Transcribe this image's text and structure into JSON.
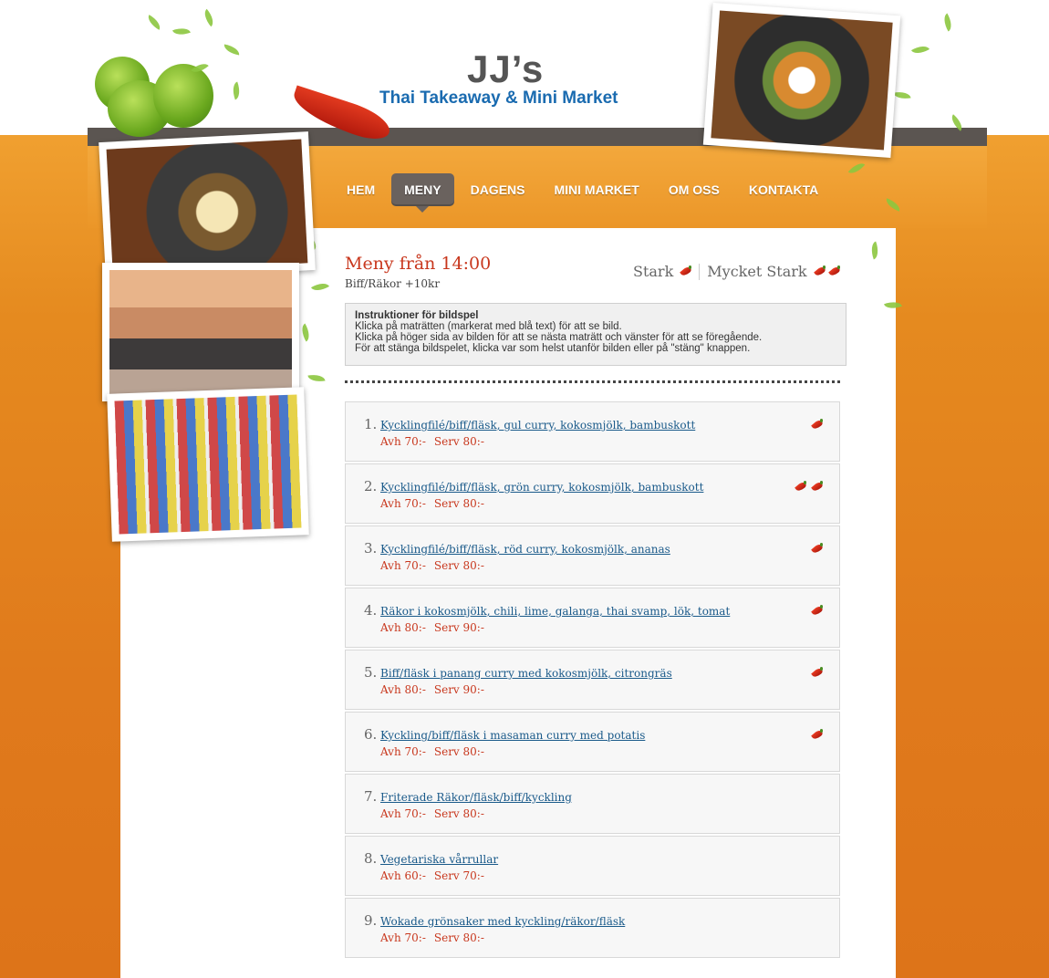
{
  "brand": {
    "title": "JJ’s",
    "subtitle": "Thai Takeaway & Mini Market"
  },
  "nav": [
    {
      "label": "HEM",
      "active": false
    },
    {
      "label": "MENY",
      "active": true
    },
    {
      "label": "DAGENS",
      "active": false
    },
    {
      "label": "MINI MARKET",
      "active": false
    },
    {
      "label": "OM OSS",
      "active": false
    },
    {
      "label": "KONTAKTA",
      "active": false
    }
  ],
  "menu": {
    "title": "Meny från 14:00",
    "subtitle": "Biff/Räkor +10kr",
    "legend": {
      "strong": "Stark",
      "very_strong": "Mycket Stark"
    }
  },
  "instructions": {
    "heading": "Instruktioner för bildspel",
    "line1": "Klicka på maträtten (markerat med blå text) för att se bild.",
    "line2": "Klicka på höger sida av bilden för att se nästa maträtt och vänster för att se föregående.",
    "line3": "För att stänga bildspelet, klicka var som helst utanför bilden eller på \"stäng\" knappen."
  },
  "items": [
    {
      "num": "1.",
      "name": "Kycklingfilé/biff/fläsk, gul curry, kokosmjölk, bambuskott",
      "avh": "Avh 70:-",
      "serv": "Serv 80:-",
      "chilis": 1
    },
    {
      "num": "2.",
      "name": "Kycklingfilé/biff/fläsk, grön curry, kokosmjölk, bambuskott",
      "avh": "Avh 70:-",
      "serv": "Serv 80:-",
      "chilis": 2
    },
    {
      "num": "3.",
      "name": "Kycklingfilé/biff/fläsk, röd curry, kokosmjölk, ananas",
      "avh": "Avh 70:-",
      "serv": "Serv 80:-",
      "chilis": 1
    },
    {
      "num": "4.",
      "name": "Räkor i kokosmjölk, chili, lime, galanga, thai svamp, lök, tomat",
      "avh": "Avh 80:-",
      "serv": "Serv 90:-",
      "chilis": 1
    },
    {
      "num": "5.",
      "name": "Biff/fläsk i panang curry med kokosmjölk, citrongräs",
      "avh": "Avh 80:-",
      "serv": "Serv 90:-",
      "chilis": 1
    },
    {
      "num": "6.",
      "name": "Kyckling/biff/fläsk i masaman curry med potatis",
      "avh": "Avh 70:-",
      "serv": "Serv 80:-",
      "chilis": 1
    },
    {
      "num": "7.",
      "name": "Friterade Räkor/fläsk/biff/kyckling",
      "avh": "Avh 70:-",
      "serv": "Serv 80:-",
      "chilis": 0
    },
    {
      "num": "8.",
      "name": "Vegetariska vårrullar",
      "avh": "Avh 60:-",
      "serv": "Serv 70:-",
      "chilis": 0
    },
    {
      "num": "9.",
      "name": "Wokade grönsaker med kyckling/räkor/fläsk",
      "avh": "Avh 70:-",
      "serv": "Serv 80:-",
      "chilis": 0
    }
  ],
  "icons": {
    "chili": "chili-pepper-icon",
    "lime": "lime-icon",
    "leaves": "leaf-vine-icon"
  }
}
